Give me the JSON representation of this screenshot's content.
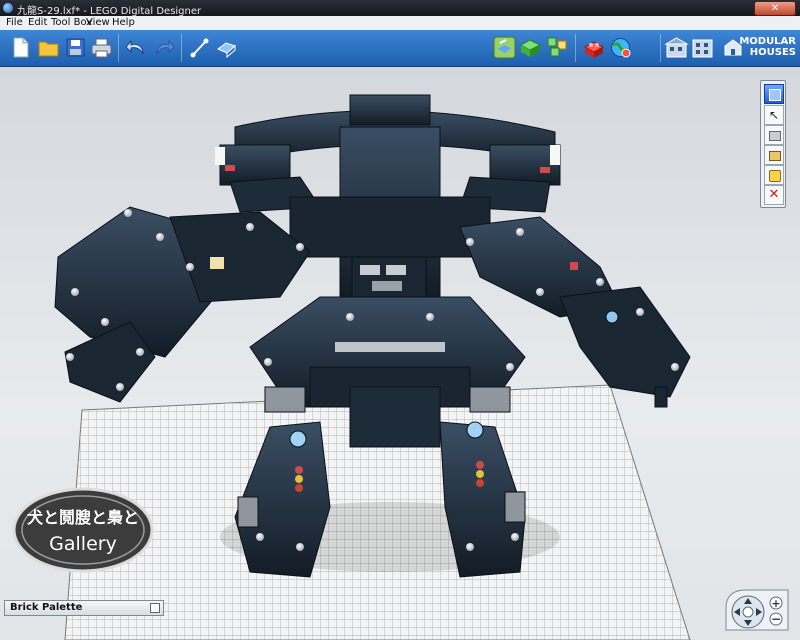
{
  "window": {
    "title": "九龍S-29.lxf* - LEGO Digital Designer"
  },
  "menu": {
    "items": [
      "File",
      "Edit",
      "Tool Box",
      "View",
      "Help"
    ]
  },
  "toolbar": {
    "buttons": [
      "new-file",
      "open-folder",
      "save-disk",
      "print",
      "undo",
      "redo",
      "hinge-tool",
      "flex-tool",
      "build-mode",
      "view-mode",
      "building-guide-mode",
      "brick-box",
      "upload-web"
    ],
    "brand_line1": "MODULAR",
    "brand_line2": "HOUSES"
  },
  "tool_strip": {
    "tools": [
      "camera",
      "select",
      "clone",
      "hinge",
      "paint",
      "delete"
    ]
  },
  "watermark": {
    "line1": "犬と鬩膄と梟と",
    "line2": "Gallery"
  },
  "brick_palette": {
    "label": "Brick Palette"
  },
  "colors": {
    "toolbar_top": "#3f86d6",
    "toolbar_bottom": "#1d5fae",
    "brick_dark": "#1d2a38",
    "baseplate": "#f4f4f4"
  }
}
